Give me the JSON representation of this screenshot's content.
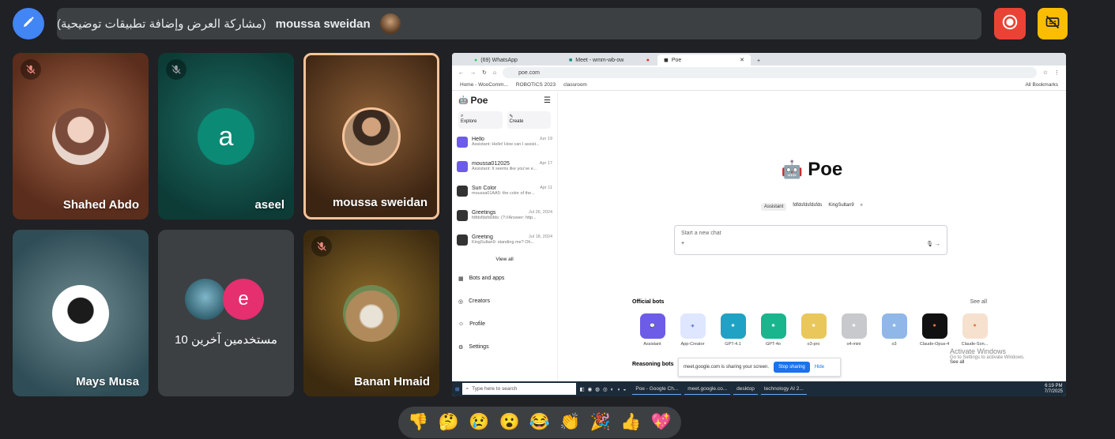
{
  "presenter": {
    "name": "moussa sweidan",
    "subtitle": "(مشاركة العرض وإضافة تطبيقات توضيحية)"
  },
  "participants": [
    {
      "name": "Shahed Abdo",
      "muted": true
    },
    {
      "name": "aseel",
      "initial": "a",
      "muted": true
    },
    {
      "name": "moussa sweidan",
      "muted": false,
      "speaking": true
    },
    {
      "name": "Mays Musa",
      "muted": false
    },
    {
      "name": "10 مستخدمين آخرين",
      "initial": "e"
    },
    {
      "name": "Banan Hmaid",
      "muted": true
    }
  ],
  "shared_screen": {
    "browser_tabs": [
      "(69) WhatsApp",
      "Meet - wmm-wb-ow",
      "Poe"
    ],
    "url": "poe.com",
    "bookmarks": [
      "Home - WooComm...",
      "ROBOTICS 2023",
      "classroom"
    ],
    "all_bookmarks": "All Bookmarks",
    "poe": {
      "logo": "Poe",
      "explore": "Explore",
      "create": "Create",
      "chats": [
        {
          "title": "Hello",
          "date": "Jun 19",
          "snippet": "Assistant: Hello! How can I assist..."
        },
        {
          "title": "moussa012025",
          "date": "Apr 17",
          "snippet": "Assistant: It seems like you've e..."
        },
        {
          "title": "Sun Color",
          "date": "Apr 11",
          "snippet": "moussa01AA5: the color of the..."
        },
        {
          "title": "Greetings",
          "date": "Jul 26, 2024",
          "snippet": "fdfdsfdsfdsfds: (?://Answer: http..."
        },
        {
          "title": "Greeting",
          "date": "Jul 18, 2024",
          "snippet": "KingSultan9: standing me? Oh..."
        }
      ],
      "view_all": "View all",
      "nav": [
        "Bots and apps",
        "Creators",
        "Profile",
        "Settings"
      ],
      "hero_title": "Poe",
      "bot_chips": [
        "Assistant",
        "fdfdsfdsfdsfds",
        "KingSultan9"
      ],
      "chat_placeholder": "Start a new chat",
      "official_bots_label": "Official bots",
      "see_all": "See all",
      "bots": [
        "Assistant",
        "App-Creator",
        "GPT-4.1",
        "GPT-4o",
        "o3-pro",
        "o4-mini",
        "o3",
        "Claude-Opus-4",
        "Claude-Son..."
      ],
      "reasoning_bots_label": "Reasoning bots",
      "share_notice": "meet.google.com is sharing your screen.",
      "stop_sharing": "Stop sharing",
      "hide": "Hide",
      "activate_title": "Activate Windows",
      "activate_sub": "Go to Settings to activate Windows.",
      "see_all_2": "See all"
    },
    "taskbar": {
      "search": "Type here to search",
      "apps": [
        "Poe - Google Ch...",
        "meet.google.co...",
        "desktop",
        "technology AI 2..."
      ],
      "time": "6:19 PM",
      "date": "7/7/2025"
    }
  },
  "reactions": [
    "👎",
    "🤔",
    "😢",
    "😮",
    "😂",
    "👏",
    "🎉",
    "👍",
    "💖"
  ],
  "colors": {
    "bg": "#202124",
    "accent_blue": "#4285f4",
    "record_red": "#ea4335",
    "cc_yellow": "#fbbc04",
    "speaking_border": "#f6c39a"
  }
}
